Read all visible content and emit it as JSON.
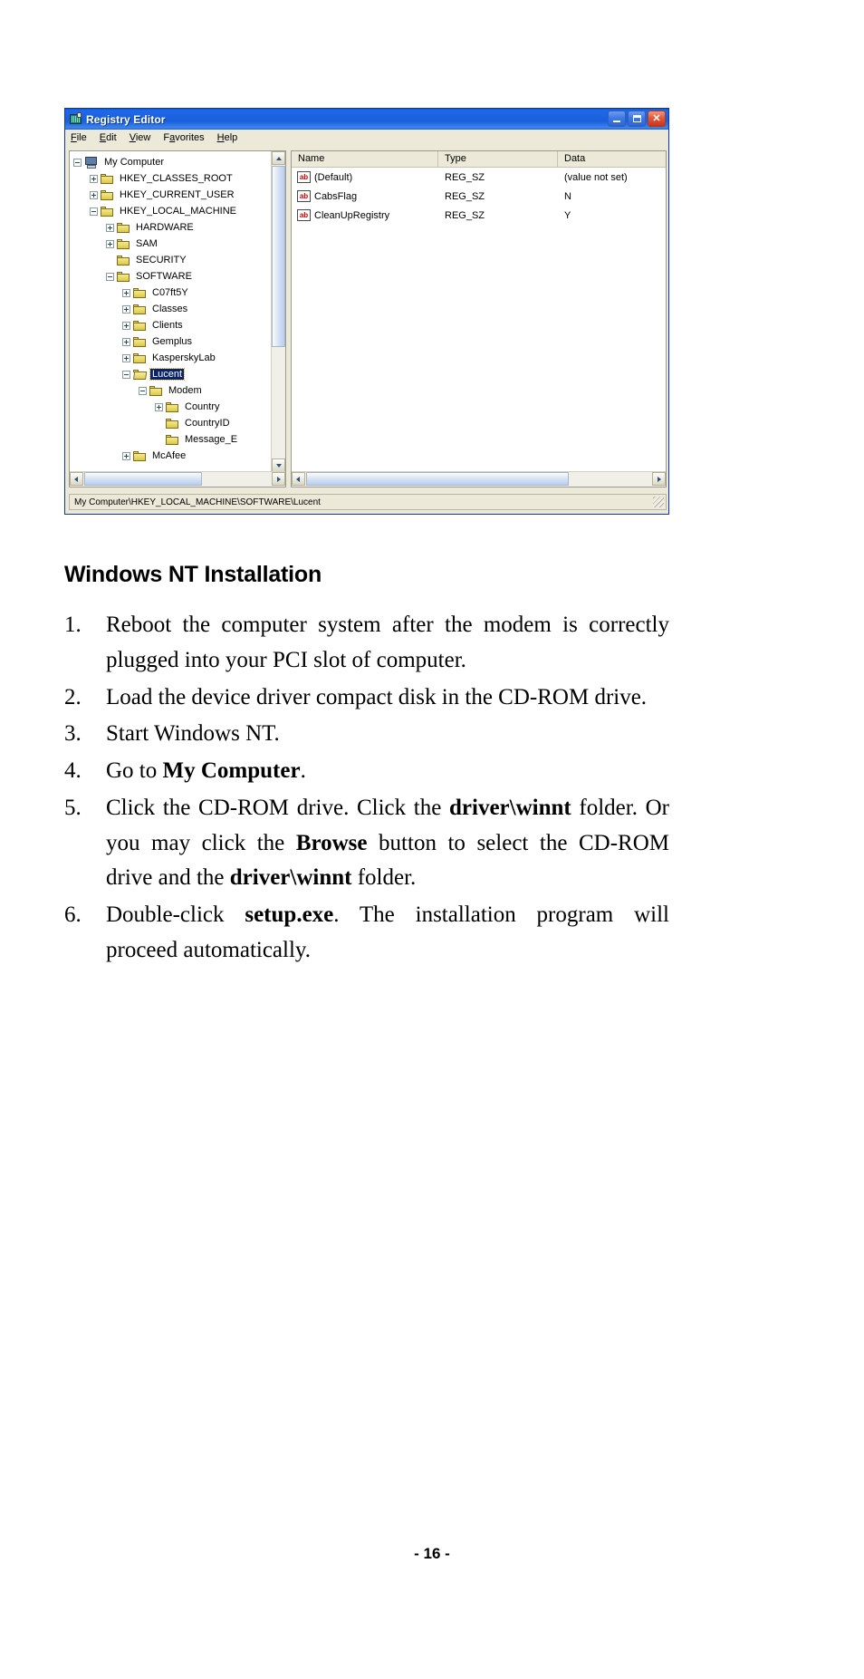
{
  "window": {
    "title": "Registry Editor",
    "icon": "registry-editor-icon",
    "buttons": {
      "minimize": "Minimize",
      "maximize": "Maximize",
      "close": "Close"
    },
    "menu": [
      {
        "label": "File",
        "accel": "F"
      },
      {
        "label": "Edit",
        "accel": "E"
      },
      {
        "label": "View",
        "accel": "V"
      },
      {
        "label": "Favorites",
        "accel": "a"
      },
      {
        "label": "Help",
        "accel": "H"
      }
    ],
    "tree": [
      {
        "label": "My Computer",
        "indent": 0,
        "expander": "minus",
        "icon": "computer-icon",
        "selected": false
      },
      {
        "label": "HKEY_CLASSES_ROOT",
        "indent": 1,
        "expander": "plus",
        "icon": "folder-icon",
        "selected": false
      },
      {
        "label": "HKEY_CURRENT_USER",
        "indent": 1,
        "expander": "plus",
        "icon": "folder-icon",
        "selected": false
      },
      {
        "label": "HKEY_LOCAL_MACHINE",
        "indent": 1,
        "expander": "minus",
        "icon": "folder-icon",
        "selected": false
      },
      {
        "label": "HARDWARE",
        "indent": 2,
        "expander": "plus",
        "icon": "folder-icon",
        "selected": false
      },
      {
        "label": "SAM",
        "indent": 2,
        "expander": "plus",
        "icon": "folder-icon",
        "selected": false
      },
      {
        "label": "SECURITY",
        "indent": 2,
        "expander": "none",
        "icon": "folder-icon",
        "selected": false
      },
      {
        "label": "SOFTWARE",
        "indent": 2,
        "expander": "minus",
        "icon": "folder-icon",
        "selected": false
      },
      {
        "label": "C07ft5Y",
        "indent": 3,
        "expander": "plus",
        "icon": "folder-icon",
        "selected": false
      },
      {
        "label": "Classes",
        "indent": 3,
        "expander": "plus",
        "icon": "folder-icon",
        "selected": false
      },
      {
        "label": "Clients",
        "indent": 3,
        "expander": "plus",
        "icon": "folder-icon",
        "selected": false
      },
      {
        "label": "Gemplus",
        "indent": 3,
        "expander": "plus",
        "icon": "folder-icon",
        "selected": false
      },
      {
        "label": "KasperskyLab",
        "indent": 3,
        "expander": "plus",
        "icon": "folder-icon",
        "selected": false
      },
      {
        "label": "Lucent",
        "indent": 3,
        "expander": "minus",
        "icon": "folder-open-icon",
        "selected": true
      },
      {
        "label": "Modem",
        "indent": 4,
        "expander": "minus",
        "icon": "folder-icon",
        "selected": false
      },
      {
        "label": "Country",
        "indent": 5,
        "expander": "plus",
        "icon": "folder-icon",
        "selected": false
      },
      {
        "label": "CountryID",
        "indent": 5,
        "expander": "none",
        "icon": "folder-icon",
        "selected": false
      },
      {
        "label": "Message_E",
        "indent": 5,
        "expander": "none",
        "icon": "folder-icon",
        "selected": false
      },
      {
        "label": "McAfee",
        "indent": 3,
        "expander": "plus",
        "icon": "folder-icon",
        "selected": false
      }
    ],
    "list": {
      "columns": [
        "Name",
        "Type",
        "Data"
      ],
      "rows": [
        {
          "icon": "string-value-icon",
          "name": "(Default)",
          "type": "REG_SZ",
          "data": "(value not set)"
        },
        {
          "icon": "string-value-icon",
          "name": "CabsFlag",
          "type": "REG_SZ",
          "data": "N"
        },
        {
          "icon": "string-value-icon",
          "name": "CleanUpRegistry",
          "type": "REG_SZ",
          "data": "Y"
        }
      ]
    },
    "status": "My Computer\\HKEY_LOCAL_MACHINE\\SOFTWARE\\Lucent"
  },
  "doc": {
    "heading": "Windows NT Installation",
    "steps": [
      {
        "num": "1.",
        "parts": [
          {
            "t": "Reboot the computer system after the modem is correctly plugged into your PCI slot of computer.",
            "b": false
          }
        ]
      },
      {
        "num": "2.",
        "parts": [
          {
            "t": "Load the device driver compact disk in the CD-ROM drive.",
            "b": false
          }
        ]
      },
      {
        "num": "3.",
        "parts": [
          {
            "t": "Start Windows NT.",
            "b": false
          }
        ]
      },
      {
        "num": "4.",
        "parts": [
          {
            "t": "Go to ",
            "b": false
          },
          {
            "t": "My Computer",
            "b": true
          },
          {
            "t": ".",
            "b": false
          }
        ]
      },
      {
        "num": "5.",
        "parts": [
          {
            "t": "Click the CD-ROM drive. Click the ",
            "b": false
          },
          {
            "t": "driver\\winnt",
            "b": true
          },
          {
            "t": " folder. Or you may click the ",
            "b": false
          },
          {
            "t": "Browse",
            "b": true
          },
          {
            "t": " button to select the CD-ROM drive and the ",
            "b": false
          },
          {
            "t": "driver\\winnt",
            "b": true
          },
          {
            "t": " folder.",
            "b": false
          }
        ]
      },
      {
        "num": "6.",
        "parts": [
          {
            "t": "Double-click ",
            "b": false
          },
          {
            "t": "setup.exe",
            "b": true
          },
          {
            "t": ". The installation program will proceed automatically.",
            "b": false
          }
        ]
      }
    ],
    "page_number": "- 16 -"
  },
  "colors": {
    "titlebar_blue": "#1b5fdc",
    "selection_blue": "#0a246a",
    "window_face": "#ece9d8",
    "folder_yellow": "#e8d46a",
    "ab_red": "#c00000"
  }
}
